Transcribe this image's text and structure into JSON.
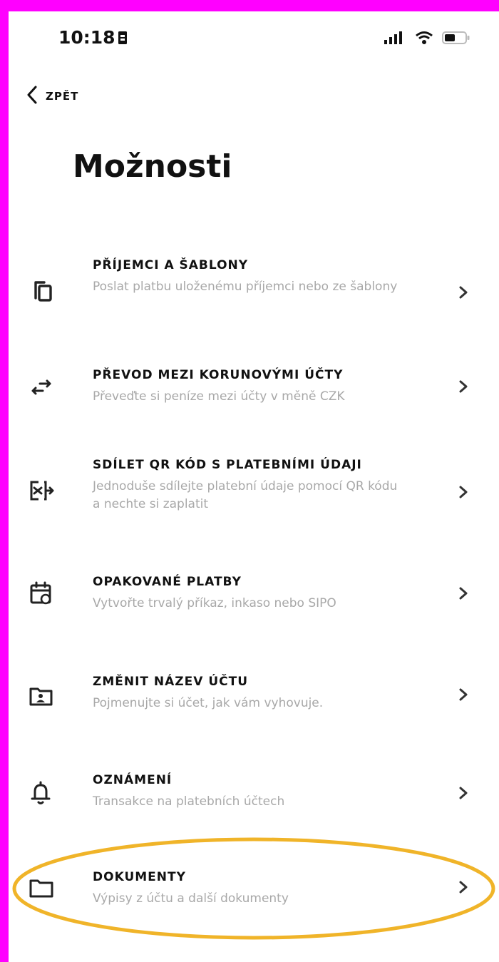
{
  "status_bar": {
    "time": "10:18",
    "icons": [
      "sim-card-icon",
      "signal-icon",
      "wifi-icon",
      "battery-icon"
    ]
  },
  "nav": {
    "back_label": "ZPĚT"
  },
  "page": {
    "title": "Možnosti"
  },
  "menu": {
    "items": [
      {
        "icon": "templates-icon",
        "title": "PŘÍJEMCI A ŠABLONY",
        "subtitle": "Poslat platbu uloženému příjemci nebo ze šablony"
      },
      {
        "icon": "transfer-arrows-icon",
        "title": "PŘEVOD MEZI KORUNOVÝMI ÚČTY",
        "subtitle": "Převeďte si peníze mezi účty v měně CZK"
      },
      {
        "icon": "qr-share-icon",
        "title": "SDÍLET QR KÓD S PLATEBNÍMI ÚDAJI",
        "subtitle": "Jednoduše sdílejte platební údaje pomocí QR kódu a nechte si zaplatit"
      },
      {
        "icon": "calendar-repeat-icon",
        "title": "OPAKOVANÉ PLATBY",
        "subtitle": "Vytvořte trvalý příkaz, inkaso nebo SIPO"
      },
      {
        "icon": "rename-folder-icon",
        "title": "ZMĚNIT NÁZEV ÚČTU",
        "subtitle": "Pojmenujte si účet, jak vám vyhovuje."
      },
      {
        "icon": "bell-icon",
        "title": "OZNÁMENÍ",
        "subtitle": "Transakce na platebních účtech"
      },
      {
        "icon": "folder-icon",
        "title": "DOKUMENTY",
        "subtitle": "Výpisy z účtu a další dokumenty"
      }
    ]
  },
  "colors": {
    "background_frame": "#ff00ff",
    "highlight_ring": "#f0b429",
    "subtitle_text": "#a8a8a8"
  }
}
